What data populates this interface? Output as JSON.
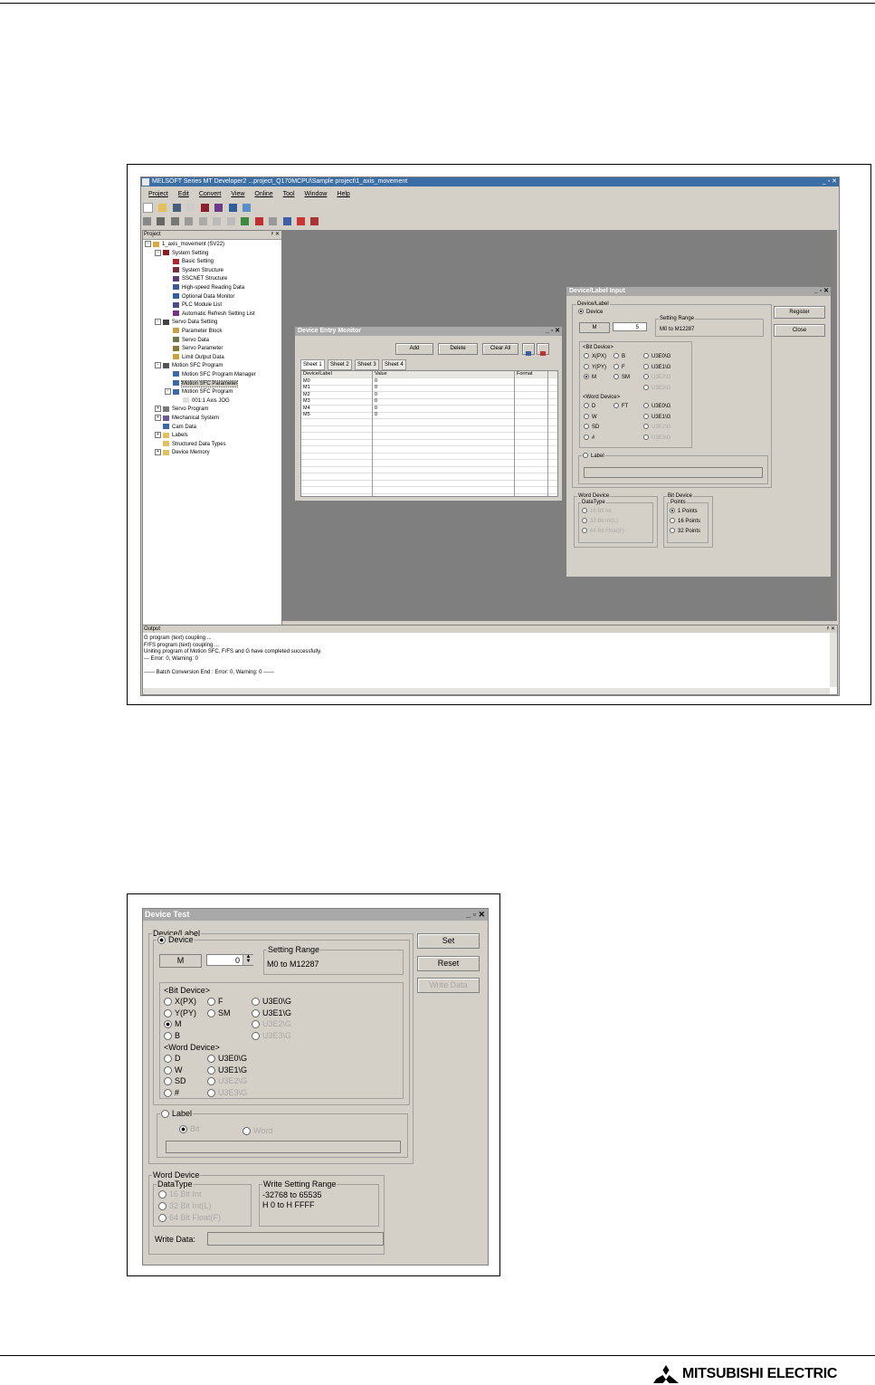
{
  "colors": {
    "mdi_background": "#7f7f7f",
    "dialog_face": "#d4d0c8",
    "title_inactive": "#a9a9a9",
    "app_title": "#3a6ea5",
    "brand_red": "#e60012"
  },
  "brand": {
    "name": "MITSUBISHI ELECTRIC",
    "logo_icon": "three-diamonds-icon"
  },
  "app": {
    "title": "MELSOFT Series MT Developer2 ...project_Q170MCPU\\Sample project\\1_axis_movement",
    "menu": [
      "Project",
      "Edit",
      "Convert",
      "View",
      "Online",
      "Tool",
      "Window",
      "Help"
    ],
    "project_panel_title": "Project",
    "tree": [
      {
        "label": "1_axis_movement (SV22)",
        "indent": 0,
        "toggle": "-",
        "icon": "project-folder-icon"
      },
      {
        "label": "System Setting",
        "indent": 1,
        "toggle": "-",
        "icon": "system-setting-icon"
      },
      {
        "label": "Basic Setting",
        "indent": 2,
        "toggle": "",
        "icon": "basic-setting-icon"
      },
      {
        "label": "System Structure",
        "indent": 2,
        "toggle": "",
        "icon": "system-structure-icon"
      },
      {
        "label": "SSCNET Structure",
        "indent": 2,
        "toggle": "",
        "icon": "sscnet-icon"
      },
      {
        "label": "High-speed Reading Data",
        "indent": 2,
        "toggle": "",
        "icon": "reading-data-icon"
      },
      {
        "label": "Optional Data Monitor",
        "indent": 2,
        "toggle": "",
        "icon": "monitor-icon"
      },
      {
        "label": "PLC Module List",
        "indent": 2,
        "toggle": "",
        "icon": "module-list-icon"
      },
      {
        "label": "Automatic Refresh Setting List",
        "indent": 2,
        "toggle": "",
        "icon": "refresh-icon"
      },
      {
        "label": "Servo Data Setting",
        "indent": 1,
        "toggle": "-",
        "icon": "servo-data-icon"
      },
      {
        "label": "Parameter Block",
        "indent": 2,
        "toggle": "",
        "icon": "parameter-block-icon"
      },
      {
        "label": "Servo Data",
        "indent": 2,
        "toggle": "",
        "icon": "servo-icon"
      },
      {
        "label": "Servo Parameter",
        "indent": 2,
        "toggle": "",
        "icon": "servo-parameter-icon"
      },
      {
        "label": "Limit Output Data",
        "indent": 2,
        "toggle": "",
        "icon": "limit-output-icon"
      },
      {
        "label": "Motion SFC Program",
        "indent": 1,
        "toggle": "-",
        "icon": "sfc-program-icon"
      },
      {
        "label": "Motion SFC Program Manager",
        "indent": 2,
        "toggle": "",
        "icon": "sfc-manager-icon"
      },
      {
        "label": "Motion SFC Parameter",
        "indent": 2,
        "toggle": "",
        "icon": "sfc-parameter-icon",
        "selected": true
      },
      {
        "label": "Motion SFC Program",
        "indent": 2,
        "toggle": "-",
        "icon": "sfc-program-icon"
      },
      {
        "label": "001:1 Axis JOG",
        "indent": 3,
        "toggle": "",
        "icon": "document-icon"
      },
      {
        "label": "Servo Program",
        "indent": 1,
        "toggle": "+",
        "icon": "servo-program-icon"
      },
      {
        "label": "Mechanical System",
        "indent": 1,
        "toggle": "+",
        "icon": "mechanical-system-icon"
      },
      {
        "label": "Cam Data",
        "indent": 1,
        "toggle": "",
        "icon": "cam-data-icon"
      },
      {
        "label": "Labels",
        "indent": 1,
        "toggle": "+",
        "icon": "folder-icon"
      },
      {
        "label": "Structured Data Types",
        "indent": 1,
        "toggle": "",
        "icon": "folder-icon"
      },
      {
        "label": "Device Memory",
        "indent": 1,
        "toggle": "+",
        "icon": "folder-icon"
      }
    ],
    "output_title": "Output",
    "output_lines": [
      "G program (text) coupling ...",
      "F/FS program (text) coupling ...",
      "Uniting program of Motion SFC, F/FS and G have completed successfully.",
      "--- Error: 0, Warning: 0",
      "",
      "------ Batch Conversion End : Error: 0, Warning: 0 ------"
    ]
  },
  "entry_monitor": {
    "title": "Device Entry Monitor",
    "buttons": {
      "add": "Add",
      "delete": "Delete",
      "clear_all": "Clear All"
    },
    "tabs": [
      "Sheet 1",
      "Sheet 2",
      "Sheet 3",
      "Sheet 4"
    ],
    "columns": [
      "Device/Label",
      "Value",
      "Format"
    ],
    "rows": [
      [
        "M0",
        "0",
        ""
      ],
      [
        "M1",
        "0",
        ""
      ],
      [
        "M2",
        "0",
        ""
      ],
      [
        "M3",
        "0",
        ""
      ],
      [
        "M4",
        "0",
        ""
      ],
      [
        "M5",
        "0",
        ""
      ]
    ]
  },
  "device_label_input": {
    "title": "Device/Label Input",
    "group": "Device/Label",
    "device_radio": "Device",
    "device_type": "M",
    "device_number": "5",
    "setting_range_title": "Setting Range",
    "setting_range": "M0 to M12287",
    "bit_device_title": "<Bit Device>",
    "bit_options": [
      {
        "label": "X(PX)",
        "checked": false,
        "disabled": false
      },
      {
        "label": "B",
        "checked": false,
        "disabled": false
      },
      {
        "label": "U3E0\\G",
        "checked": false,
        "disabled": false
      },
      {
        "label": "Y(PY)",
        "checked": false,
        "disabled": false
      },
      {
        "label": "F",
        "checked": false,
        "disabled": false
      },
      {
        "label": "U3E1\\G",
        "checked": false,
        "disabled": false
      },
      {
        "label": "M",
        "checked": true,
        "disabled": false
      },
      {
        "label": "SM",
        "checked": false,
        "disabled": false
      },
      {
        "label": "U3E2\\G",
        "checked": false,
        "disabled": true
      },
      {
        "label": "",
        "checked": false,
        "disabled": false
      },
      {
        "label": "",
        "checked": false,
        "disabled": false
      },
      {
        "label": "U3E3\\G",
        "checked": false,
        "disabled": true
      }
    ],
    "word_device_title": "<Word Device>",
    "word_options": [
      {
        "label": "D",
        "checked": false,
        "disabled": false
      },
      {
        "label": "FT",
        "checked": false,
        "disabled": false
      },
      {
        "label": "U3E0\\G",
        "checked": false,
        "disabled": false
      },
      {
        "label": "W",
        "checked": false,
        "disabled": false
      },
      {
        "label": "",
        "checked": false,
        "disabled": false
      },
      {
        "label": "U3E1\\G",
        "checked": false,
        "disabled": false
      },
      {
        "label": "SD",
        "checked": false,
        "disabled": false
      },
      {
        "label": "",
        "checked": false,
        "disabled": false
      },
      {
        "label": "U3E2\\G",
        "checked": false,
        "disabled": true
      },
      {
        "label": "#",
        "checked": false,
        "disabled": false
      },
      {
        "label": "",
        "checked": false,
        "disabled": false
      },
      {
        "label": "U3E3\\G",
        "checked": false,
        "disabled": true
      }
    ],
    "label_radio": "Label",
    "register_button": "Register",
    "close_button": "Close",
    "word_device_group": "Word Device",
    "datatype_title": "DataType",
    "datatypes": [
      "16 Bit Int",
      "32 Bit Int(L)",
      "64 Bit Float(F)"
    ],
    "bit_device_group": "Bit Device",
    "points_title": "Points",
    "points": [
      "1 Points",
      "16 Points",
      "32 Points"
    ]
  },
  "device_test": {
    "title": "Device Test",
    "group": "Device/Label",
    "device_radio": "Device",
    "device_type": "M",
    "device_number": "0",
    "setting_range_title": "Setting Range",
    "setting_range": "M0 to M12287",
    "bit_device_title": "<Bit Device>",
    "bit_options": [
      {
        "label": "X(PX)",
        "checked": false,
        "disabled": false
      },
      {
        "label": "F",
        "checked": false,
        "disabled": false
      },
      {
        "label": "U3E0\\G",
        "checked": false,
        "disabled": false
      },
      {
        "label": "Y(PY)",
        "checked": false,
        "disabled": false
      },
      {
        "label": "SM",
        "checked": false,
        "disabled": false
      },
      {
        "label": "U3E1\\G",
        "checked": false,
        "disabled": false
      },
      {
        "label": "M",
        "checked": true,
        "disabled": false
      },
      {
        "label": "",
        "checked": false,
        "disabled": false
      },
      {
        "label": "U3E2\\G",
        "checked": false,
        "disabled": true
      },
      {
        "label": "B",
        "checked": false,
        "disabled": false
      },
      {
        "label": "",
        "checked": false,
        "disabled": false
      },
      {
        "label": "U3E3\\G",
        "checked": false,
        "disabled": true
      }
    ],
    "word_device_title": "<Word Device>",
    "word_options": [
      {
        "label": "D",
        "checked": false,
        "disabled": false
      },
      {
        "label": "U3E0\\G",
        "checked": false,
        "disabled": false
      },
      {
        "label": "W",
        "checked": false,
        "disabled": false
      },
      {
        "label": "U3E1\\G",
        "checked": false,
        "disabled": false
      },
      {
        "label": "SD",
        "checked": false,
        "disabled": false
      },
      {
        "label": "U3E2\\G",
        "checked": false,
        "disabled": true
      },
      {
        "label": "#",
        "checked": false,
        "disabled": false
      },
      {
        "label": "U3E3\\G",
        "checked": false,
        "disabled": true
      }
    ],
    "label_radio": "Label",
    "label_bit": "Bit",
    "label_word": "Word",
    "set_button": "Set",
    "reset_button": "Reset",
    "write_data_button": "Write Data",
    "word_device_group": "Word Device",
    "datatype_title": "DataType",
    "datatypes": [
      "16 Bit Int",
      "32 Bit Int(L)",
      "64 Bit Float(F)"
    ],
    "write_range_title": "Write Setting Range",
    "write_range_line1": "-32768 to 65535",
    "write_range_line2": "H 0 to H FFFF",
    "write_data_label": "Write Data:"
  }
}
